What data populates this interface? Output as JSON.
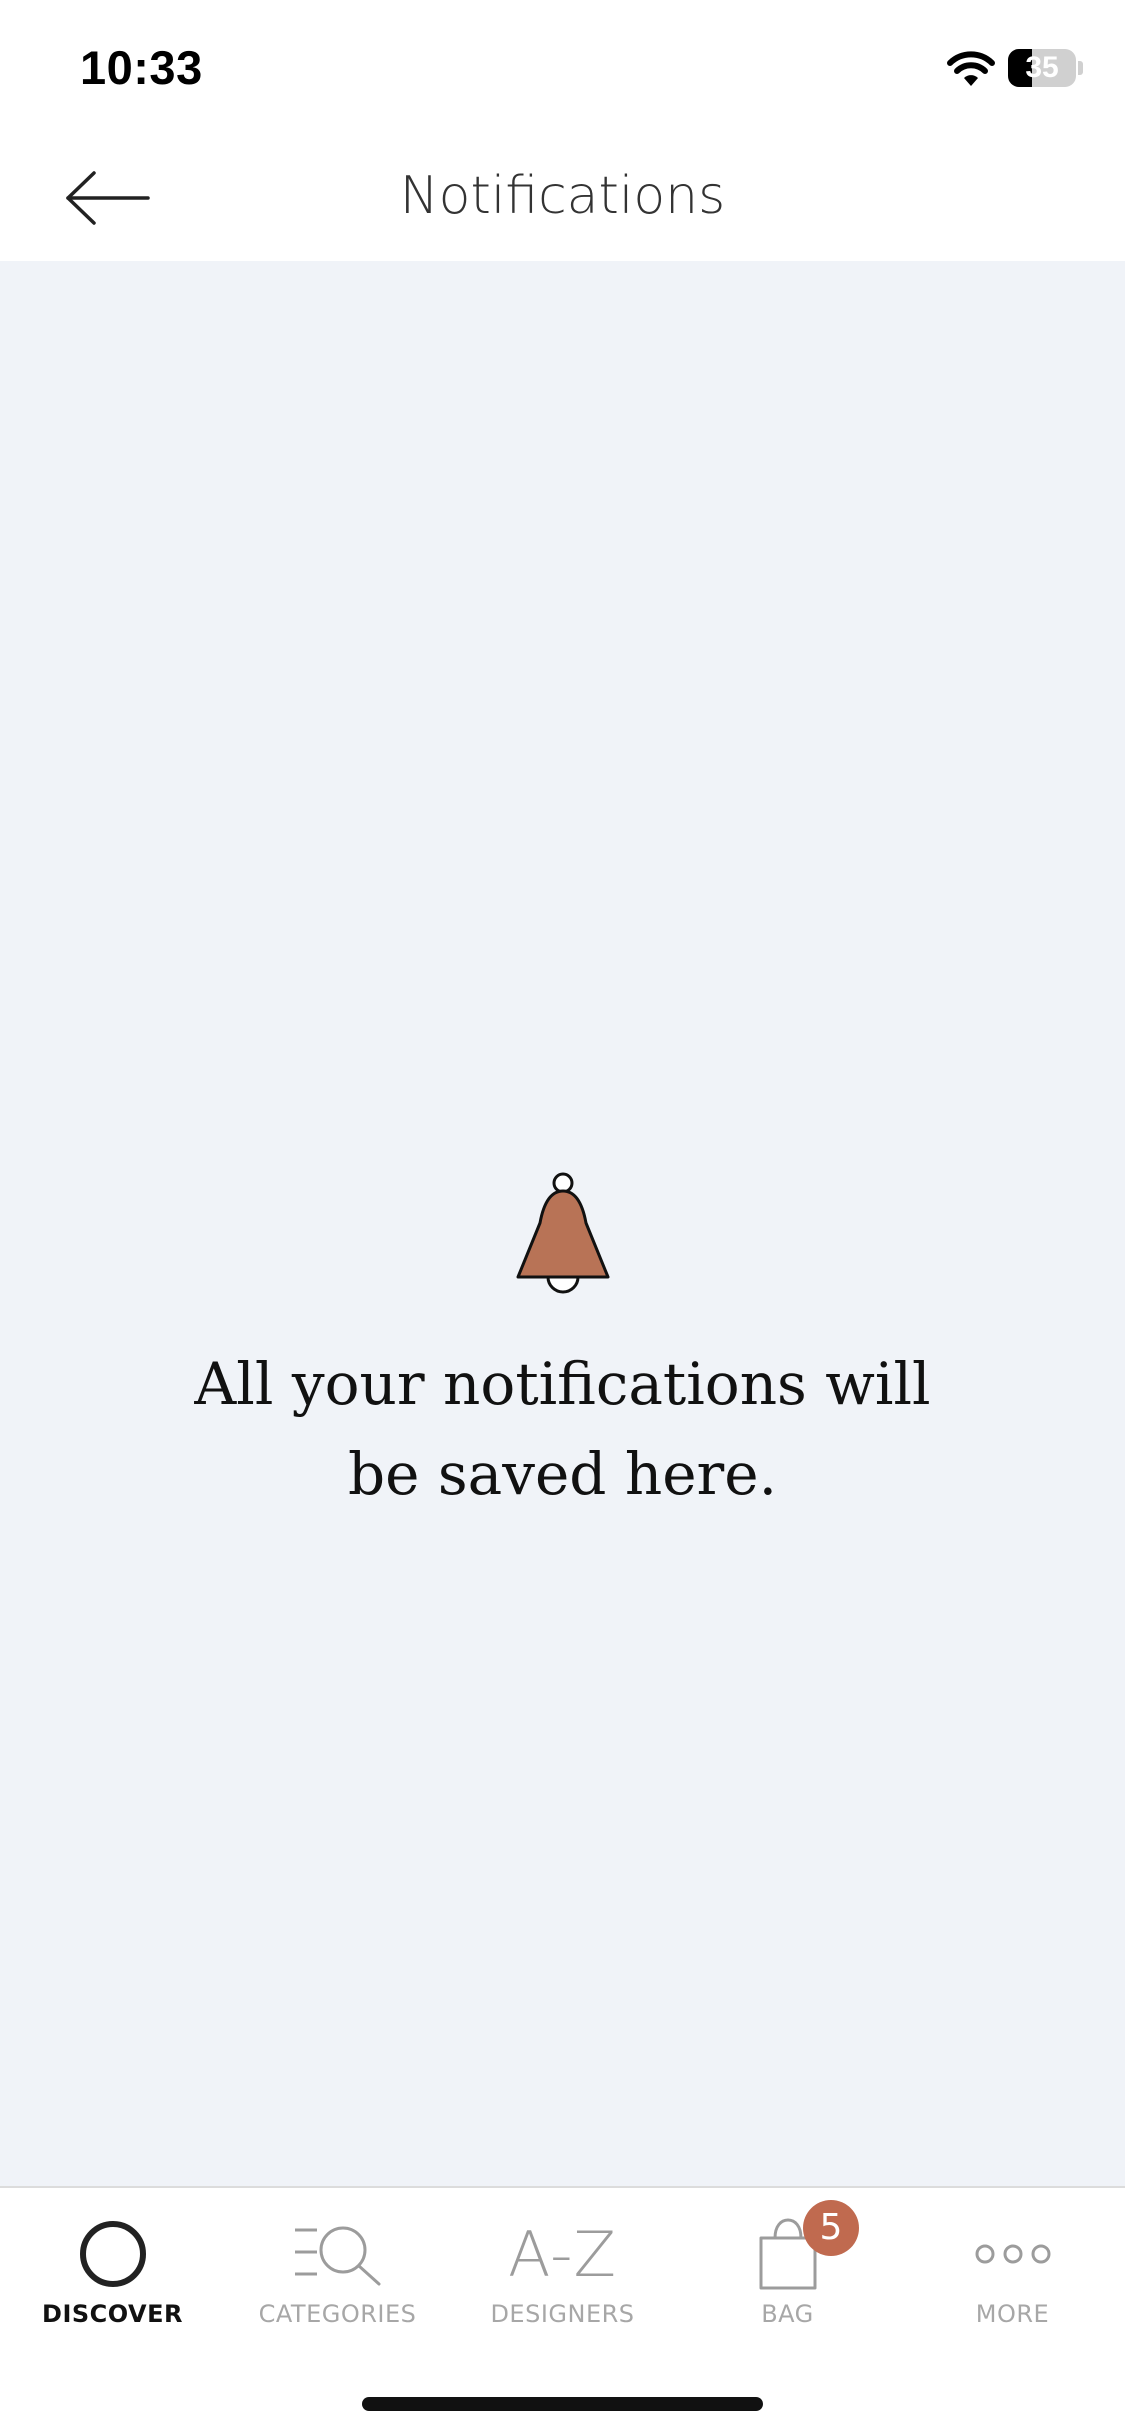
{
  "status_bar": {
    "time": "10:33",
    "battery_level": 35,
    "battery_text": "35"
  },
  "header": {
    "back_icon": "arrow-left-icon",
    "title": "Notifications"
  },
  "empty_state": {
    "icon": "bell-icon",
    "icon_color": "#b87356",
    "message": "All your notifications will be saved here."
  },
  "tab_bar": {
    "tabs": [
      {
        "label": "DISCOVER",
        "icon": "circle-icon",
        "active": true
      },
      {
        "label": "CATEGORIES",
        "icon": "categories-search-icon",
        "active": false
      },
      {
        "label": "DESIGNERS",
        "icon": "a-z-icon",
        "icon_text": "A-Z",
        "active": false
      },
      {
        "label": "BAG",
        "icon": "shopping-bag-icon",
        "badge": "5",
        "active": false
      },
      {
        "label": "MORE",
        "icon": "more-dots-icon",
        "active": false
      }
    ],
    "badge_color": "#c06a4f"
  }
}
